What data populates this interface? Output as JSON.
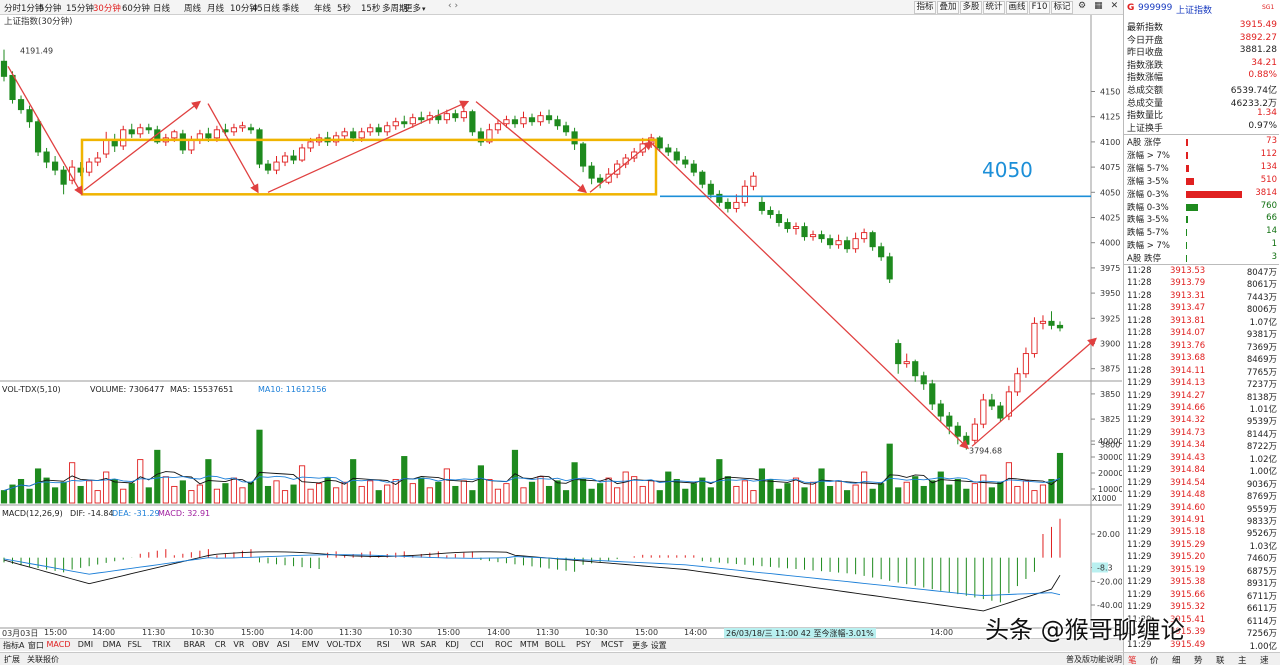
{
  "periods": [
    "分时",
    "1分钟",
    "5分钟",
    "15分钟",
    "30分钟",
    "60分钟",
    "日线",
    "周线",
    "月线",
    "10分钟",
    "45日线",
    "季线",
    "年线",
    "5秒",
    "15秒",
    "多周期",
    "更多"
  ],
  "active_period": "30分钟",
  "toolbar": [
    "指标",
    "叠加",
    "多股",
    "统计",
    "画线",
    "F10",
    "标记"
  ],
  "chart_title": "上证指数(30分钟)",
  "high_label": "4191.49",
  "low_label": "3794.68",
  "annotation_4050": "4050",
  "price_axis": [
    "4150",
    "4125",
    "4100",
    "4075",
    "4050",
    "4025",
    "4000",
    "3975",
    "3950",
    "3925",
    "3900",
    "3875",
    "3850",
    "3825",
    "3800"
  ],
  "vol_header": {
    "name": "VOL-TDX(5,10)",
    "volume": "VOLUME: 7306477",
    "ma5": "MA5: 15537651",
    "ma10": "MA10: 11612156"
  },
  "vol_axis": [
    "40000",
    "30000",
    "20000",
    "10000"
  ],
  "vol_unit": "X1000",
  "macd_header": {
    "name": "MACD(12,26,9)",
    "dif": "DIF: -14.84",
    "dea": "DEA: -31.29",
    "macd": "MACD: 32.91"
  },
  "macd_axis": [
    "20.00",
    "-8.3",
    "-20.00",
    "-40.00"
  ],
  "time_axis": [
    "03月03日",
    "15:00",
    "14:00",
    "11:30",
    "10:30",
    "15:00",
    "14:00",
    "11:30",
    "10:30",
    "15:00",
    "14:00",
    "11:30",
    "10:30",
    "15:00",
    "14:00",
    "11:30",
    "10:30",
    "14:00"
  ],
  "cursor_info": "26/03/18/三 11:00 42 至今涨幅-3.01%",
  "bottom_tabs": [
    "指标A",
    "窗口",
    "MACD",
    "DMI",
    "DMA",
    "FSL",
    "TRIX",
    "BRAR",
    "CR",
    "VR",
    "OBV",
    "ASI",
    "EMV",
    "VOL-TDX",
    "RSI",
    "WR",
    "SAR",
    "KDJ",
    "CCI",
    "ROC",
    "MTM",
    "BOLL",
    "PSY",
    "MCST",
    "更多",
    "设置"
  ],
  "active_bottom_tab": "MACD",
  "expand_label": "扩展",
  "news_label": "关联报价",
  "right": {
    "g": "G",
    "code": "999999",
    "name": "上证指数",
    "tag": "SG1",
    "stats": [
      {
        "label": "最新指数",
        "value": "3915.49",
        "cls": "up"
      },
      {
        "label": "今日开盘",
        "value": "3892.27",
        "cls": "up"
      },
      {
        "label": "昨日收盘",
        "value": "3881.28",
        "cls": "bk"
      },
      {
        "label": "指数涨跌",
        "value": "34.21",
        "cls": "up"
      },
      {
        "label": "指数涨幅",
        "value": "0.88%",
        "cls": "up"
      },
      {
        "label": "总成交额",
        "value": "6539.74亿",
        "cls": "bk"
      },
      {
        "label": "总成交量",
        "value": "46233.2万",
        "cls": "bk"
      },
      {
        "label": "指数量比",
        "value": "1.34",
        "cls": "up"
      },
      {
        "label": "上证换手",
        "value": "0.97%",
        "cls": "bk"
      }
    ],
    "dist": [
      {
        "label": "A股 涨停",
        "value": "73",
        "cls": "up",
        "bar": 2
      },
      {
        "label": "涨幅 > 7%",
        "value": "112",
        "cls": "up",
        "bar": 2
      },
      {
        "label": "涨幅 5-7%",
        "value": "134",
        "cls": "up",
        "bar": 3
      },
      {
        "label": "涨幅 3-5%",
        "value": "510",
        "cls": "up",
        "bar": 8
      },
      {
        "label": "涨幅 0-3%",
        "value": "3814",
        "cls": "up",
        "bar": 56
      },
      {
        "label": "跌幅 0-3%",
        "value": "760",
        "cls": "dn",
        "bar": 12
      },
      {
        "label": "跌幅 3-5%",
        "value": "66",
        "cls": "dn",
        "bar": 2
      },
      {
        "label": "跌幅 5-7%",
        "value": "14",
        "cls": "dn",
        "bar": 1
      },
      {
        "label": "跌幅 > 7%",
        "value": "1",
        "cls": "dn",
        "bar": 1
      },
      {
        "label": "A股 跌停",
        "value": "3",
        "cls": "dn",
        "bar": 1
      }
    ],
    "ticks": [
      {
        "t": "11:28",
        "p": "3913.53",
        "v": "8047万",
        "c": "up"
      },
      {
        "t": "11:28",
        "p": "3913.79",
        "v": "8061万",
        "c": "up"
      },
      {
        "t": "11:28",
        "p": "3913.31",
        "v": "7443万",
        "c": "up"
      },
      {
        "t": "11:28",
        "p": "3913.47",
        "v": "8006万",
        "c": "up"
      },
      {
        "t": "11:28",
        "p": "3913.81",
        "v": "1.07亿",
        "c": "up"
      },
      {
        "t": "11:28",
        "p": "3914.07",
        "v": "9381万",
        "c": "up"
      },
      {
        "t": "11:28",
        "p": "3913.76",
        "v": "7369万",
        "c": "up"
      },
      {
        "t": "11:28",
        "p": "3913.68",
        "v": "8469万",
        "c": "up"
      },
      {
        "t": "11:28",
        "p": "3914.11",
        "v": "7765万",
        "c": "up"
      },
      {
        "t": "11:29",
        "p": "3914.13",
        "v": "7237万",
        "c": "up"
      },
      {
        "t": "11:29",
        "p": "3914.27",
        "v": "8138万",
        "c": "up"
      },
      {
        "t": "11:29",
        "p": "3914.66",
        "v": "1.01亿",
        "c": "up"
      },
      {
        "t": "11:29",
        "p": "3914.32",
        "v": "9539万",
        "c": "up"
      },
      {
        "t": "11:29",
        "p": "3914.73",
        "v": "8144万",
        "c": "up"
      },
      {
        "t": "11:29",
        "p": "3914.34",
        "v": "8722万",
        "c": "up"
      },
      {
        "t": "11:29",
        "p": "3914.43",
        "v": "1.02亿",
        "c": "up"
      },
      {
        "t": "11:29",
        "p": "3914.84",
        "v": "1.00亿",
        "c": "up"
      },
      {
        "t": "11:29",
        "p": "3914.54",
        "v": "9036万",
        "c": "up"
      },
      {
        "t": "11:29",
        "p": "3914.48",
        "v": "8769万",
        "c": "up"
      },
      {
        "t": "11:29",
        "p": "3914.60",
        "v": "9559万",
        "c": "up"
      },
      {
        "t": "11:29",
        "p": "3914.91",
        "v": "9833万",
        "c": "up"
      },
      {
        "t": "11:29",
        "p": "3915.18",
        "v": "9526万",
        "c": "up"
      },
      {
        "t": "11:29",
        "p": "3915.29",
        "v": "1.03亿",
        "c": "up"
      },
      {
        "t": "11:29",
        "p": "3915.20",
        "v": "7460万",
        "c": "up"
      },
      {
        "t": "11:29",
        "p": "3915.19",
        "v": "6875万",
        "c": "up"
      },
      {
        "t": "11:29",
        "p": "3915.38",
        "v": "8931万",
        "c": "up"
      },
      {
        "t": "11:29",
        "p": "3915.66",
        "v": "6711万",
        "c": "up"
      },
      {
        "t": "11:29",
        "p": "3915.32",
        "v": "6611万",
        "c": "up"
      },
      {
        "t": "11:29",
        "p": "3915.41",
        "v": "6114万",
        "c": "up"
      },
      {
        "t": "11:29",
        "p": "3915.39",
        "v": "7256万",
        "c": "up"
      },
      {
        "t": "11:29",
        "p": "3915.49",
        "v": "1.00亿",
        "c": "up"
      }
    ],
    "footer": [
      "笔",
      "价",
      "细",
      "势",
      "联",
      "主",
      "速"
    ],
    "source_note": "普及版功能说明"
  },
  "watermark": "头条 @猴哥聊缠论",
  "colors": {
    "up": "#e02020",
    "down": "#1e8a1e",
    "box": "#f0b400",
    "hline": "#1c8fd8",
    "arrow": "#e04040",
    "ma5": "#111111",
    "ma10": "#1c7fd8"
  }
}
